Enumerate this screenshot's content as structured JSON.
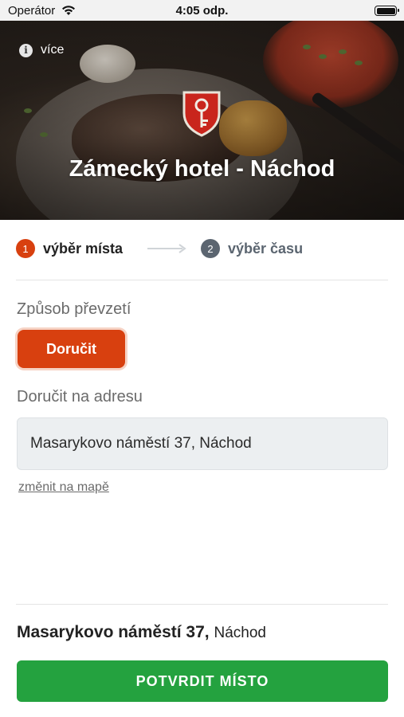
{
  "status_bar": {
    "carrier": "Operátor",
    "time": "4:05 odp."
  },
  "hero": {
    "more_label": "více",
    "title": "Zámecký hotel - Náchod"
  },
  "steps": [
    {
      "number": "1",
      "label": "výběr místa",
      "active": true
    },
    {
      "number": "2",
      "label": "výběr času",
      "active": false
    }
  ],
  "pickup": {
    "label": "Způsob převzetí",
    "selected_option": "Doručit"
  },
  "address": {
    "label": "Doručit na adresu",
    "value": "Masarykovo náměstí 37, Náchod",
    "map_link": "změnit na mapě"
  },
  "summary": {
    "street": "Masarykovo náměstí 37,",
    "city": "Náchod"
  },
  "confirm_button": "POTVRDIT MÍSTO",
  "colors": {
    "accent": "#d8400f",
    "confirm": "#24a23f",
    "muted": "#5b6570"
  }
}
